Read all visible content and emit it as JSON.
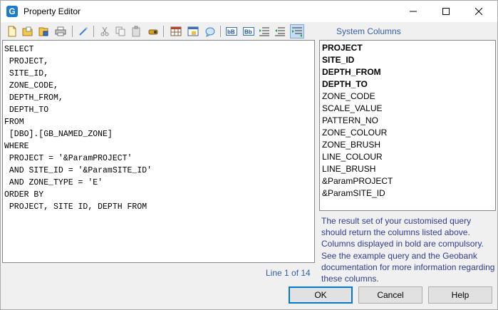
{
  "window": {
    "title": "Property Editor",
    "app_icon_letter": "G"
  },
  "toolbar": {
    "buttons": [
      "new-icon",
      "open-icon",
      "save-icon",
      "print-icon",
      "wand-icon",
      "cut-icon",
      "copy-icon",
      "paste-icon",
      "find-icon",
      "grid-icon",
      "table-icon",
      "chat-icon",
      "bb-icon",
      "bb2-icon",
      "indent-icon",
      "outdent-icon",
      "list-icon"
    ]
  },
  "system_columns_label": "System Columns",
  "editor": {
    "lines": [
      "SELECT",
      " PROJECT,",
      " SITE_ID,",
      " ZONE_CODE,",
      " DEPTH_FROM,",
      " DEPTH_TO",
      "FROM",
      " [DBO].[GB_NAMED_ZONE]",
      "WHERE",
      " PROJECT = '&ParamPROJECT'",
      " AND SITE_ID = '&ParamSITE_ID'",
      " AND ZONE_TYPE = 'E'",
      "ORDER BY",
      " PROJECT, SITE ID, DEPTH FROM"
    ]
  },
  "line_info": "Line 1 of 14",
  "columns": [
    {
      "name": "PROJECT",
      "bold": true
    },
    {
      "name": "SITE_ID",
      "bold": true
    },
    {
      "name": "DEPTH_FROM",
      "bold": true
    },
    {
      "name": "DEPTH_TO",
      "bold": true
    },
    {
      "name": "ZONE_CODE",
      "bold": false
    },
    {
      "name": "SCALE_VALUE",
      "bold": false
    },
    {
      "name": "PATTERN_NO",
      "bold": false
    },
    {
      "name": "ZONE_COLOUR",
      "bold": false
    },
    {
      "name": "ZONE_BRUSH",
      "bold": false
    },
    {
      "name": "LINE_COLOUR",
      "bold": false
    },
    {
      "name": "LINE_BRUSH",
      "bold": false
    },
    {
      "name": "&ParamPROJECT",
      "bold": false
    },
    {
      "name": "&ParamSITE_ID",
      "bold": false
    }
  ],
  "info_text": "The result set of your customised query should return the columns listed above. Columns displayed in bold are compulsory. See the example query and the Geobank documentation for more information regarding these columns.",
  "buttons": {
    "ok": "OK",
    "cancel": "Cancel",
    "help": "Help"
  },
  "colors": {
    "accent": "#0078d7",
    "label_blue": "#2f5fa8",
    "app_icon": "#1a7bd0"
  }
}
